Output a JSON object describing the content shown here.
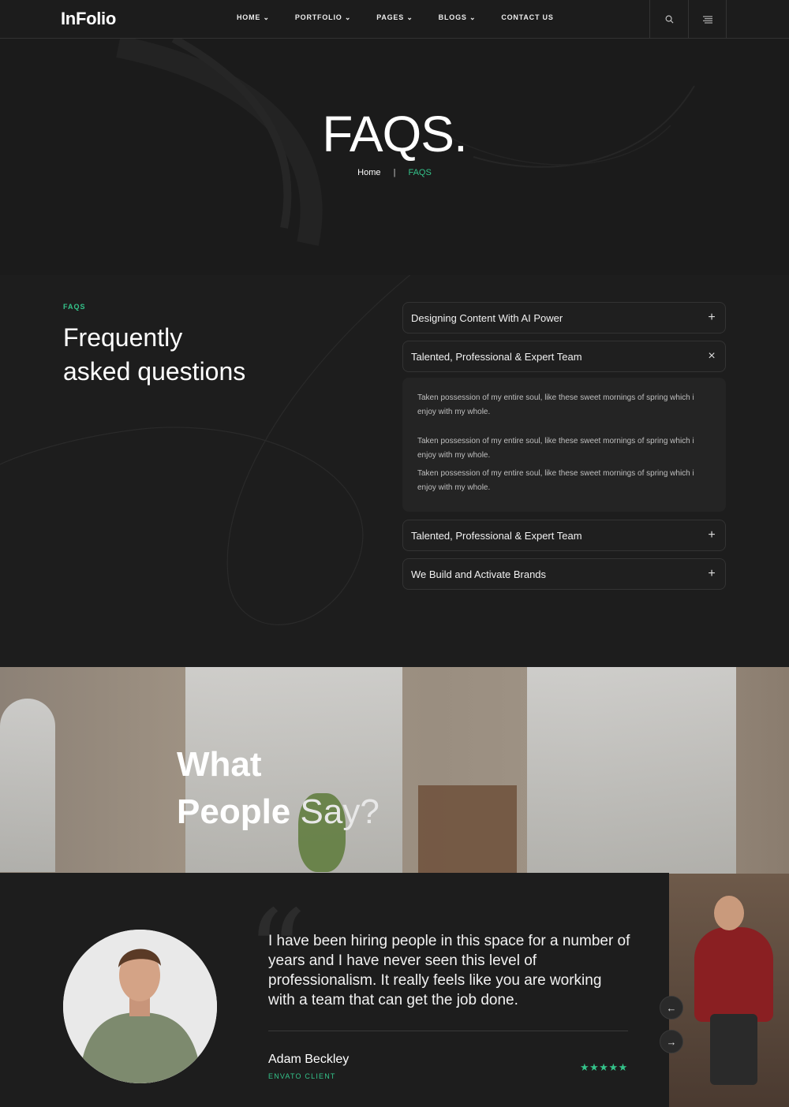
{
  "nav": {
    "logo": "InFolio",
    "menu": [
      "HOME ⌄",
      "PORTFOLIO ⌄",
      "PAGES ⌄",
      "BLOGS ⌄",
      "CONTACT US"
    ],
    "search_icon": "search-icon",
    "menu_icon": "hamburger-icon"
  },
  "hero": {
    "title": "FAQS.",
    "breadcrumb_home": "Home",
    "breadcrumb_sep": "|",
    "breadcrumb_current": "FAQS"
  },
  "faq": {
    "eyebrow": "FAQS",
    "heading_line1": "Frequently",
    "heading_line2": "asked questions",
    "items": [
      {
        "title": "Designing Content With AI Power",
        "icon": "+"
      },
      {
        "title": "Talented, Professional & Expert Team",
        "icon": "×"
      },
      {
        "title": "Talented, Professional & Expert Team",
        "icon": "+"
      },
      {
        "title": "We Build and Activate Brands",
        "icon": "+"
      }
    ],
    "answer": [
      "Taken possession of my entire soul, like these sweet mornings of spring which i enjoy with my whole.",
      "Taken possession of my entire soul, like these sweet mornings of spring which i enjoy with my whole.",
      "Taken possession of my entire soul, like these sweet mornings of spring which i enjoy with my whole."
    ]
  },
  "testimonials": {
    "heading_line1": "What",
    "heading_line2_bold": "People",
    "heading_line2_light": "Say?",
    "quote_mark": "“",
    "quote": "I have been hiring people in this space for a number of years and I have never seen this level of professionalism. It really feels like you are working with a team that can get the job done.",
    "author": "Adam Beckley",
    "role": "ENVATO CLIENT",
    "stars": "★★★★★",
    "prev_arrow": "←",
    "next_arrow": "→"
  },
  "colors": {
    "accent": "#34c38a",
    "background": "#1d1d1d"
  }
}
